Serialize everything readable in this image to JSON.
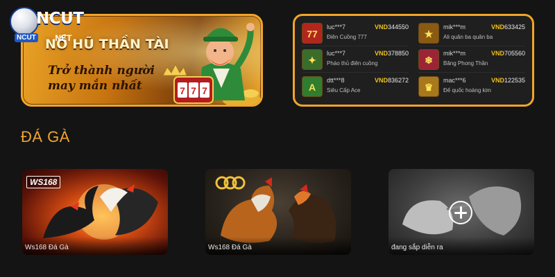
{
  "logo": {
    "text": "NCUT",
    "suffix": ".NET",
    "ball_label": "NCUT"
  },
  "banner": {
    "title": "NỔ HŨ THẦN TÀI",
    "subtitle": "Trở thành người may mắn nhất",
    "reels": [
      "7",
      "7",
      "7"
    ]
  },
  "winners": [
    {
      "user": "luc***7",
      "game": "Điên Cuồng 777",
      "currency": "VND",
      "amount": "344550",
      "thumb_text": "77",
      "thumb_color": "#b3261e"
    },
    {
      "user": "mik***m",
      "game": "Ali quân ba quân ba",
      "currency": "VND",
      "amount": "633425",
      "thumb_text": "★",
      "thumb_color": "#8a5a12"
    },
    {
      "user": "luc***7",
      "game": "Pháo thủ điên cuồng",
      "currency": "VND",
      "amount": "378850",
      "thumb_text": "✦",
      "thumb_color": "#3a6d2a"
    },
    {
      "user": "mik***m",
      "game": "Băng Phong Thần",
      "currency": "VND",
      "amount": "705560",
      "thumb_text": "❄",
      "thumb_color": "#9b2436"
    },
    {
      "user": "dtt***8",
      "game": "Siêu Cấp Ace",
      "currency": "VND",
      "amount": "836272",
      "thumb_text": "A",
      "thumb_color": "#2f7d2e"
    },
    {
      "user": "mac***6",
      "game": "Đế quốc hoàng kim",
      "currency": "VND",
      "amount": "122535",
      "thumb_text": "♛",
      "thumb_color": "#a8781a"
    }
  ],
  "section": {
    "title": "ĐÁ GÀ"
  },
  "cards": [
    {
      "label": "Ws168 Đá Gà",
      "badge": "WS168"
    },
    {
      "label": "Ws168 Đá Gà",
      "badge": "CO"
    },
    {
      "label": "đang sắp diễn ra",
      "icon": "plus-circle-icon"
    }
  ],
  "colors": {
    "accent": "#f0a62c",
    "currency": "#f3c21a",
    "background": "#141414"
  }
}
